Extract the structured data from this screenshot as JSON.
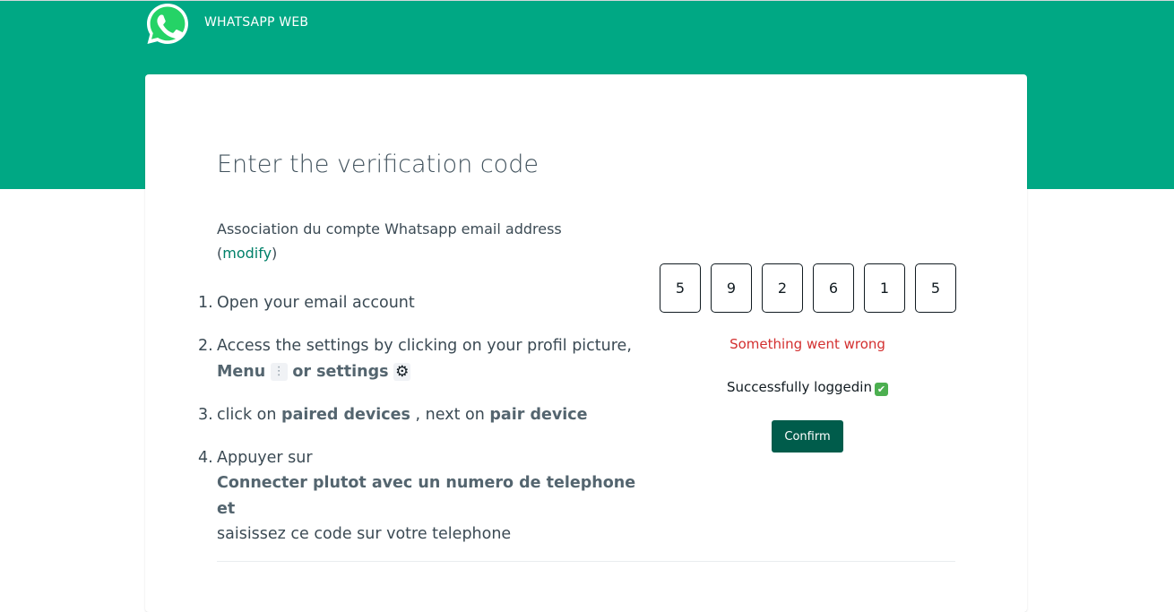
{
  "header": {
    "brand": "WHATSAPP WEB"
  },
  "colors": {
    "accent": "#00a884",
    "button": "#005c4b",
    "error": "#d32f2f",
    "link": "#008069"
  },
  "card": {
    "title": "Enter the verification code",
    "association": {
      "text": "Association du compte Whatsapp email address",
      "open_paren": "(",
      "link": "modify",
      "close_paren": ")"
    },
    "steps": [
      {
        "num": "1.",
        "text": "Open your email account"
      },
      {
        "num": "2.",
        "text": "Access the settings by clicking on your profil picture,",
        "bold_menu": "Menu",
        "menu_icon": "⋮",
        "bold_settings": "or settings",
        "settings_icon": "⚙"
      },
      {
        "num": "3.",
        "pre": "click on",
        "bold1": "paired devices",
        "mid": ", next on",
        "bold2": "pair device"
      },
      {
        "num": "4.",
        "pre": "Appuyer sur",
        "bold": "Connecter plutot avec un numero de telephone et",
        "post": "saisissez ce code sur votre telephone"
      }
    ]
  },
  "code": {
    "digits": [
      "5",
      "9",
      "2",
      "6",
      "1",
      "5"
    ]
  },
  "status": {
    "error": "Something went wrong",
    "success": "Successfully loggedin",
    "success_icon": "✔"
  },
  "confirm_label": "Confirm"
}
